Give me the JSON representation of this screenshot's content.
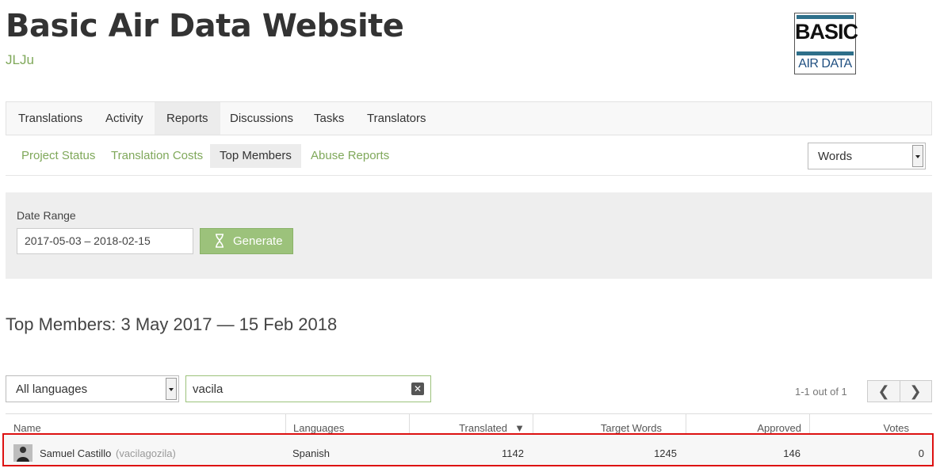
{
  "header": {
    "title": "Basic Air Data Website",
    "subtitle": "JLJu",
    "logo": {
      "line1": "BASIC",
      "line2": "AIR DATA"
    }
  },
  "main_nav": [
    "Translations",
    "Activity",
    "Reports",
    "Discussions",
    "Tasks",
    "Translators"
  ],
  "main_nav_active": "Reports",
  "sub_nav": [
    "Project Status",
    "Translation Costs",
    "Top Members",
    "Abuse Reports"
  ],
  "sub_nav_active": "Top Members",
  "units_select": {
    "value": "Words"
  },
  "filter": {
    "date_label": "Date Range",
    "date_value": "2017-05-03 – 2018-02-15",
    "generate_label": "Generate"
  },
  "heading": "Top Members: 3 May 2017 — 15 Feb 2018",
  "language_select": {
    "value": "All languages"
  },
  "search": {
    "value": "vacila",
    "clear_icon": "✕"
  },
  "pagination": {
    "count": "1-1 out of 1",
    "prev": "❮",
    "next": "❯"
  },
  "table": {
    "columns": [
      "Name",
      "Languages",
      "Translated",
      "Target Words",
      "Approved",
      "Votes"
    ],
    "sort_indicator": "▼",
    "rows": [
      {
        "name": "Samuel Castillo",
        "username": "(vacilagozila)",
        "languages": "Spanish",
        "translated": "1142",
        "target_words": "1245",
        "approved": "146",
        "votes": "0"
      }
    ]
  },
  "colors": {
    "accent_green": "#7fa85a",
    "button_green": "#9cc27b",
    "highlight_red": "#dd1111"
  }
}
